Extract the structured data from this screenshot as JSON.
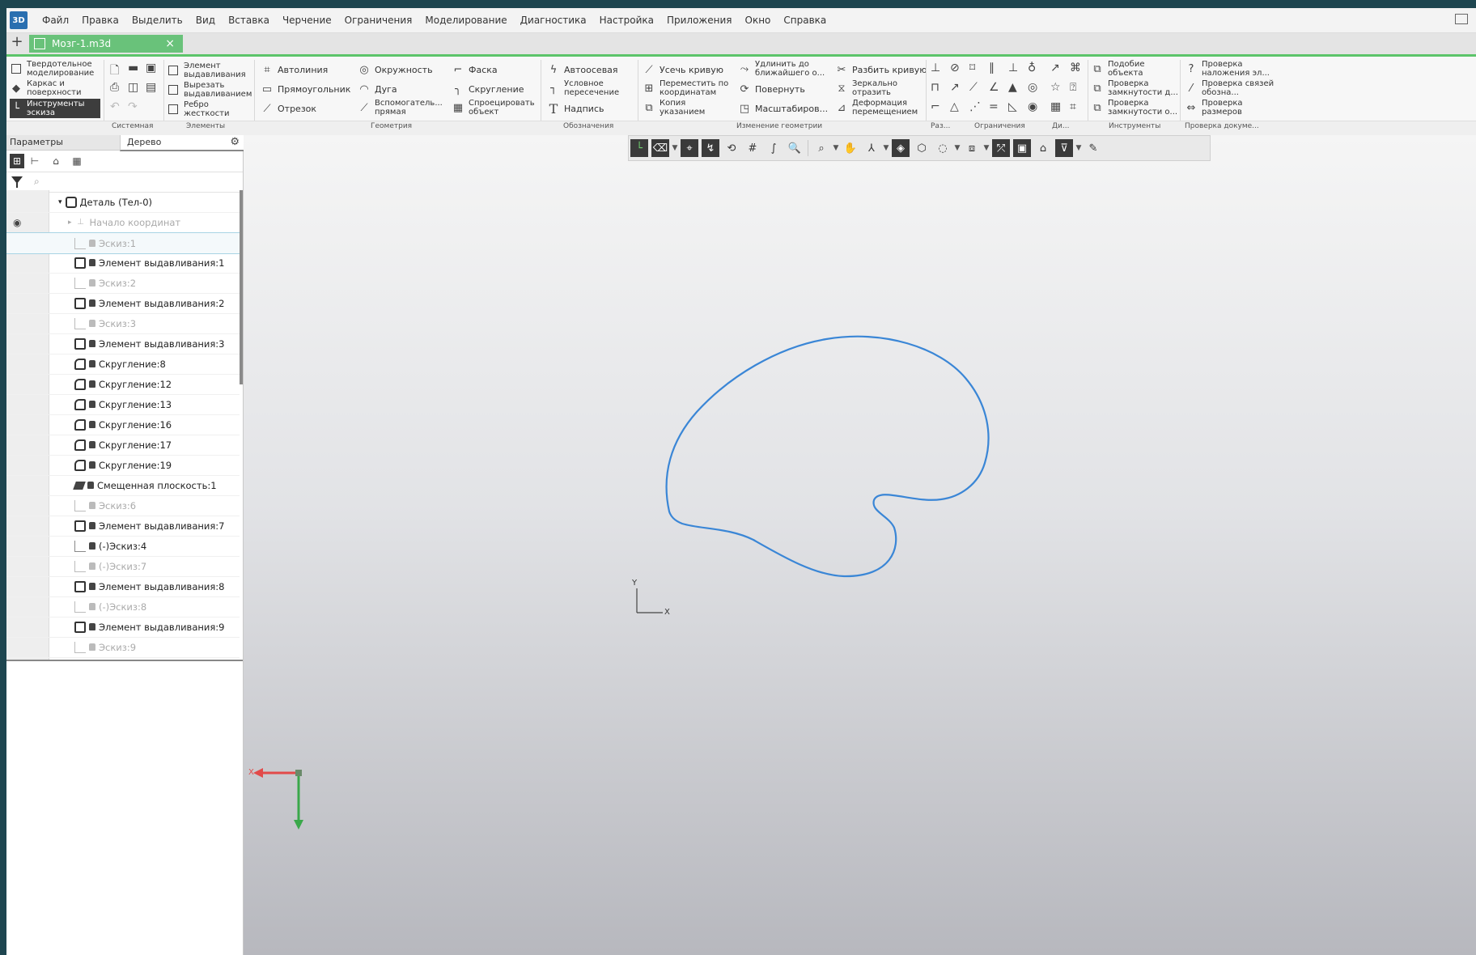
{
  "window": {
    "app_logo": "3D",
    "menu": [
      "Файл",
      "Правка",
      "Выделить",
      "Вид",
      "Вставка",
      "Черчение",
      "Ограничения",
      "Моделирование",
      "Диагностика",
      "Настройка",
      "Приложения",
      "Окно",
      "Справка"
    ]
  },
  "tabs": {
    "document": "Мозг-1.m3d"
  },
  "ribbon": {
    "modes": {
      "solid": "Твердотельное моделирование",
      "wire": "Каркас и поверхности",
      "sketch_tools": "Инструменты эскиза"
    },
    "elements": {
      "extrude": "Элемент выдавливания",
      "cut_extrude": "Вырезать выдавливанием",
      "rib": "Ребро жесткости"
    },
    "geometry": {
      "autoline": "Автолиния",
      "rectangle": "Прямоугольник",
      "segment": "Отрезок",
      "circle": "Окружность",
      "arc": "Дуга",
      "aux_line": "Вспомогатель... прямая",
      "chamfer": "Фаска",
      "fillet": "Скругление",
      "project": "Спроецировать объект"
    },
    "notation": {
      "axis": "Автоосевая",
      "intersection": "Условное пересечение",
      "label": "Надпись"
    },
    "edit_geometry": {
      "trim": "Усечь кривую",
      "extend": "Удлинить до ближайшего о...",
      "split": "Разбить кривую",
      "move_coords": "Переместить по координатам",
      "rotate": "Повернуть",
      "mirror": "Зеркально отразить",
      "copy": "Копия указанием",
      "scale": "Масштабиров...",
      "deform": "Деформация перемещением"
    },
    "tools": {
      "similarity": "Подобие объекта",
      "check_closed_1": "Проверка замкнутости д...",
      "check_closed_2": "Проверка замкнутости о..."
    },
    "doc_check": {
      "overlap": "Проверка наложения эл...",
      "links": "Проверка связей обозна...",
      "sizes": "Проверка размеров"
    },
    "group_labels": {
      "system": "Системная",
      "elements": "Элементы",
      "geometry": "Геометрия",
      "notation": "Обозначения",
      "edit_geometry": "Изменение геометрии",
      "ras": "Рaз...",
      "constraints": "Ограничения",
      "di": "Ди...",
      "tools": "Инструменты",
      "doc_check": "Проверка докуме..."
    }
  },
  "left_panel": {
    "tab_params": "Параметры",
    "tab_tree": "Дерево",
    "search_placeholder": "⌕",
    "tree": [
      {
        "label": "Деталь (Тел-0)",
        "type": "part",
        "dim": false
      },
      {
        "label": "Начало координат",
        "type": "origin",
        "dim": true
      },
      {
        "label": "Эскиз:1",
        "type": "sketch",
        "dim": true
      },
      {
        "label": "Элемент выдавливания:1",
        "type": "extrude",
        "dim": false
      },
      {
        "label": "Эскиз:2",
        "type": "sketch",
        "dim": true
      },
      {
        "label": "Элемент выдавливания:2",
        "type": "extrude",
        "dim": false
      },
      {
        "label": "Эскиз:3",
        "type": "sketch",
        "dim": true
      },
      {
        "label": "Элемент выдавливания:3",
        "type": "extrude",
        "dim": false
      },
      {
        "label": "Скругление:8",
        "type": "fillet",
        "dim": false
      },
      {
        "label": "Скругление:12",
        "type": "fillet",
        "dim": false
      },
      {
        "label": "Скругление:13",
        "type": "fillet",
        "dim": false
      },
      {
        "label": "Скругление:16",
        "type": "fillet",
        "dim": false
      },
      {
        "label": "Скругление:17",
        "type": "fillet",
        "dim": false
      },
      {
        "label": "Скругление:19",
        "type": "fillet",
        "dim": false
      },
      {
        "label": "Смещенная плоскость:1",
        "type": "plane",
        "dim": false
      },
      {
        "label": "Эскиз:6",
        "type": "sketch",
        "dim": true
      },
      {
        "label": "Элемент выдавливания:7",
        "type": "extrude",
        "dim": false
      },
      {
        "label": "(-)Эскиз:4",
        "type": "sketch",
        "dim": false
      },
      {
        "label": "(-)Эскиз:7",
        "type": "sketch",
        "dim": true
      },
      {
        "label": "Элемент выдавливания:8",
        "type": "extrude",
        "dim": false
      },
      {
        "label": "(-)Эскиз:8",
        "type": "sketch",
        "dim": true
      },
      {
        "label": "Элемент выдавливания:9",
        "type": "extrude",
        "dim": false
      },
      {
        "label": "Эскиз:9",
        "type": "sketch",
        "dim": true
      }
    ]
  },
  "canvas": {
    "axis_x": "X",
    "axis_y": "Y",
    "curve_color": "#3a86d6"
  }
}
